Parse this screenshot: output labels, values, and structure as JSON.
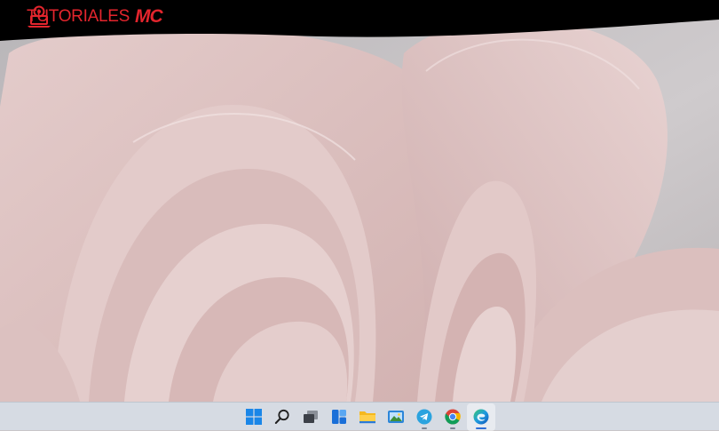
{
  "banner": {
    "brand_text": "TUTORIALES",
    "brand_suffix": "MC",
    "logo_icon": "webcam-laptop-icon"
  },
  "colors": {
    "brand_red": "#e3252d",
    "banner_bg": "#000000",
    "taskbar_bg": "#d6dbe3",
    "wallpaper_bg": "#c9c6c8",
    "petal": "#dcc0c0"
  },
  "taskbar": {
    "items": [
      {
        "icon": "windows-start-icon",
        "running": false,
        "active": false
      },
      {
        "icon": "search-icon",
        "running": false,
        "active": false
      },
      {
        "icon": "task-view-icon",
        "running": false,
        "active": false
      },
      {
        "icon": "widgets-icon",
        "running": false,
        "active": false
      },
      {
        "icon": "file-explorer-icon",
        "running": false,
        "active": false
      },
      {
        "icon": "photos-icon",
        "running": false,
        "active": false
      },
      {
        "icon": "telegram-icon",
        "running": true,
        "active": false
      },
      {
        "icon": "chrome-icon",
        "running": true,
        "active": false
      },
      {
        "icon": "edge-icon",
        "running": true,
        "active": true
      }
    ]
  }
}
